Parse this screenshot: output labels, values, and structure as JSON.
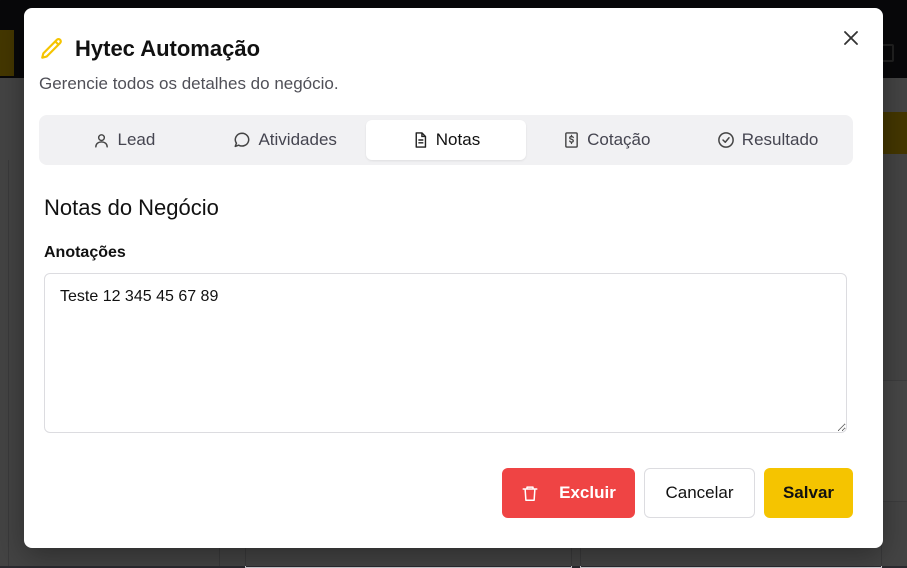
{
  "dialog": {
    "title": "Hytec Automação",
    "subtitle": "Gerencie todos os detalhes do negócio.",
    "title_icon": "pencil-icon",
    "close_icon": "close-icon",
    "accent_color": "#f5c400"
  },
  "tabs": [
    {
      "label": "Lead",
      "icon": "user-icon",
      "active": false
    },
    {
      "label": "Atividades",
      "icon": "chat-bubble-icon",
      "active": false
    },
    {
      "label": "Notas",
      "icon": "document-icon",
      "active": true
    },
    {
      "label": "Cotação",
      "icon": "dollar-document-icon",
      "active": false
    },
    {
      "label": "Resultado",
      "icon": "check-circle-icon",
      "active": false
    }
  ],
  "section": {
    "title": "Notas do Negócio",
    "field_label": "Anotações",
    "notes_value": "Teste 12 345 45 67 89"
  },
  "actions": {
    "delete_label": "Excluir",
    "cancel_label": "Cancelar",
    "save_label": "Salvar",
    "delete_color": "#ef4444",
    "save_color": "#f5c400"
  }
}
